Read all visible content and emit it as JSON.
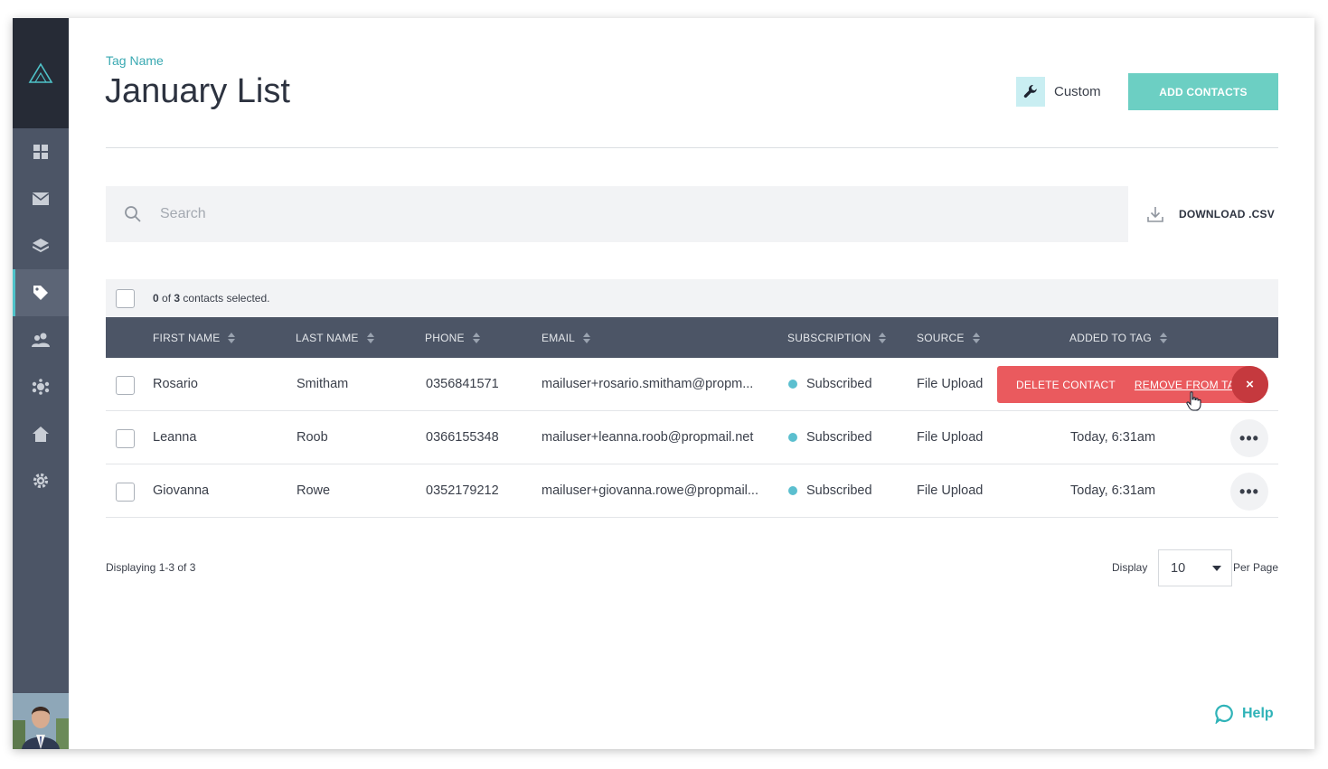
{
  "header": {
    "tag_label": "Tag Name",
    "title": "January List",
    "custom_label": "Custom",
    "add_contacts_label": "ADD CONTACTS"
  },
  "search": {
    "placeholder": "Search",
    "download_label": "DOWNLOAD .CSV"
  },
  "selection": {
    "selected_count": "0",
    "of_word": "of",
    "total": "3",
    "suffix": "contacts selected."
  },
  "table": {
    "columns": [
      "FIRST NAME",
      "LAST NAME",
      "PHONE",
      "EMAIL",
      "SUBSCRIPTION",
      "SOURCE",
      "ADDED TO TAG"
    ],
    "rows": [
      {
        "first": "Rosario",
        "last": "Smitham",
        "phone": "0356841571",
        "email": "mailuser+rosario.smitham@propm...",
        "subscription": "Subscribed",
        "source": "File Upload",
        "added": ""
      },
      {
        "first": "Leanna",
        "last": "Roob",
        "phone": "0366155348",
        "email": "mailuser+leanna.roob@propmail.net",
        "subscription": "Subscribed",
        "source": "File Upload",
        "added": "Today, 6:31am"
      },
      {
        "first": "Giovanna",
        "last": "Rowe",
        "phone": "0352179212",
        "email": "mailuser+giovanna.rowe@propmail...",
        "subscription": "Subscribed",
        "source": "File Upload",
        "added": "Today, 6:31am"
      }
    ],
    "row_actions": {
      "delete_label": "DELETE CONTACT",
      "remove_label": "REMOVE FROM TAG",
      "close_glyph": "×"
    },
    "more_glyph": "•••"
  },
  "footer": {
    "displaying": "Displaying 1-3 of 3",
    "display_label": "Display",
    "per_page_value": "10",
    "per_page_label": "Per Page",
    "help_label": "Help"
  },
  "colors": {
    "sidebar": "#4c5566",
    "sidebar_top": "#262b36",
    "accent_teal": "#6ccfc3",
    "danger": "#ea5a5e",
    "danger_dark": "#c5393e",
    "subscribed_dot": "#5bbfcf"
  },
  "icons": {
    "logo": "triangle-logo-icon",
    "nav": [
      "dashboard-icon",
      "mail-icon",
      "layers-icon",
      "tag-icon",
      "contacts-icon",
      "groups-icon",
      "home-icon",
      "settings-icon"
    ],
    "active_nav": "tag-icon"
  }
}
